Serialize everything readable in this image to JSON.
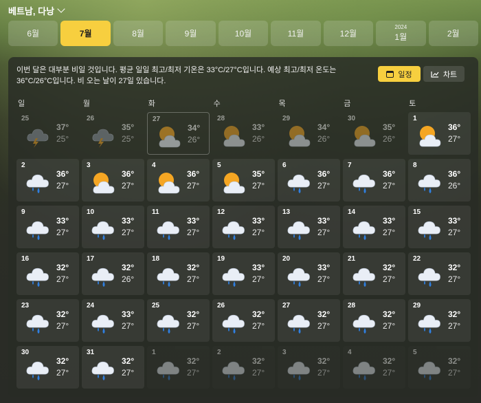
{
  "location": {
    "name": "베트남, 다낭"
  },
  "months": [
    {
      "label": "6월",
      "year": ""
    },
    {
      "label": "7월",
      "year": "",
      "active": true
    },
    {
      "label": "8월",
      "year": ""
    },
    {
      "label": "9월",
      "year": ""
    },
    {
      "label": "10월",
      "year": ""
    },
    {
      "label": "11월",
      "year": ""
    },
    {
      "label": "12월",
      "year": ""
    },
    {
      "label": "1월",
      "year": "2024"
    },
    {
      "label": "2월",
      "year": ""
    }
  ],
  "summary": "이번 달은 대부분 비일 것입니다. 평균 일일 최고/최저 기온은 33°C/27°C입니다. 예상 최고/최저 온도는 36°C/26°C입니다. 비 오는 날이 27일 있습니다.",
  "view_toggle": {
    "calendar_label": "일정",
    "chart_label": "차트"
  },
  "weekdays": [
    "일",
    "월",
    "화",
    "수",
    "목",
    "금",
    "토"
  ],
  "days": [
    {
      "d": "25",
      "hi": "37°",
      "lo": "25°",
      "icon": "thunderstorm-icon",
      "state": "dim"
    },
    {
      "d": "26",
      "hi": "35°",
      "lo": "25°",
      "icon": "thunderstorm-icon",
      "state": "dim"
    },
    {
      "d": "27",
      "hi": "34°",
      "lo": "26°",
      "icon": "partly-cloudy-icon",
      "state": "today"
    },
    {
      "d": "28",
      "hi": "33°",
      "lo": "26°",
      "icon": "partly-cloudy-icon",
      "state": "dim"
    },
    {
      "d": "29",
      "hi": "34°",
      "lo": "26°",
      "icon": "partly-cloudy-icon",
      "state": "dim"
    },
    {
      "d": "30",
      "hi": "35°",
      "lo": "26°",
      "icon": "partly-cloudy-icon",
      "state": "dim"
    },
    {
      "d": "1",
      "hi": "36°",
      "lo": "27°",
      "icon": "partly-cloudy-icon",
      "state": "normal"
    },
    {
      "d": "2",
      "hi": "36°",
      "lo": "27°",
      "icon": "rain-icon",
      "state": "normal"
    },
    {
      "d": "3",
      "hi": "36°",
      "lo": "27°",
      "icon": "partly-cloudy-icon",
      "state": "normal"
    },
    {
      "d": "4",
      "hi": "36°",
      "lo": "27°",
      "icon": "partly-cloudy-icon",
      "state": "normal"
    },
    {
      "d": "5",
      "hi": "35°",
      "lo": "27°",
      "icon": "partly-cloudy-icon",
      "state": "normal"
    },
    {
      "d": "6",
      "hi": "36°",
      "lo": "27°",
      "icon": "rain-icon",
      "state": "normal"
    },
    {
      "d": "7",
      "hi": "36°",
      "lo": "27°",
      "icon": "rain-icon",
      "state": "normal"
    },
    {
      "d": "8",
      "hi": "36°",
      "lo": "26°",
      "icon": "rain-icon",
      "state": "normal"
    },
    {
      "d": "9",
      "hi": "33°",
      "lo": "27°",
      "icon": "rain-icon",
      "state": "normal"
    },
    {
      "d": "10",
      "hi": "33°",
      "lo": "27°",
      "icon": "rain-icon",
      "state": "normal"
    },
    {
      "d": "11",
      "hi": "33°",
      "lo": "27°",
      "icon": "rain-icon",
      "state": "normal"
    },
    {
      "d": "12",
      "hi": "33°",
      "lo": "27°",
      "icon": "rain-icon",
      "state": "normal"
    },
    {
      "d": "13",
      "hi": "33°",
      "lo": "27°",
      "icon": "rain-icon",
      "state": "normal"
    },
    {
      "d": "14",
      "hi": "33°",
      "lo": "27°",
      "icon": "rain-icon",
      "state": "normal"
    },
    {
      "d": "15",
      "hi": "33°",
      "lo": "27°",
      "icon": "rain-icon",
      "state": "normal"
    },
    {
      "d": "16",
      "hi": "32°",
      "lo": "27°",
      "icon": "rain-icon",
      "state": "normal"
    },
    {
      "d": "17",
      "hi": "32°",
      "lo": "26°",
      "icon": "rain-icon",
      "state": "normal"
    },
    {
      "d": "18",
      "hi": "32°",
      "lo": "27°",
      "icon": "rain-icon",
      "state": "normal"
    },
    {
      "d": "19",
      "hi": "33°",
      "lo": "27°",
      "icon": "rain-icon",
      "state": "normal"
    },
    {
      "d": "20",
      "hi": "33°",
      "lo": "27°",
      "icon": "rain-icon",
      "state": "normal"
    },
    {
      "d": "21",
      "hi": "32°",
      "lo": "27°",
      "icon": "rain-icon",
      "state": "normal"
    },
    {
      "d": "22",
      "hi": "32°",
      "lo": "27°",
      "icon": "rain-icon",
      "state": "normal"
    },
    {
      "d": "23",
      "hi": "32°",
      "lo": "27°",
      "icon": "rain-icon",
      "state": "normal"
    },
    {
      "d": "24",
      "hi": "33°",
      "lo": "27°",
      "icon": "rain-icon",
      "state": "normal"
    },
    {
      "d": "25",
      "hi": "32°",
      "lo": "27°",
      "icon": "rain-icon",
      "state": "normal"
    },
    {
      "d": "26",
      "hi": "32°",
      "lo": "27°",
      "icon": "rain-icon",
      "state": "normal"
    },
    {
      "d": "27",
      "hi": "32°",
      "lo": "27°",
      "icon": "rain-icon",
      "state": "normal"
    },
    {
      "d": "28",
      "hi": "32°",
      "lo": "27°",
      "icon": "rain-icon",
      "state": "normal"
    },
    {
      "d": "29",
      "hi": "32°",
      "lo": "27°",
      "icon": "rain-icon",
      "state": "normal"
    },
    {
      "d": "30",
      "hi": "32°",
      "lo": "27°",
      "icon": "rain-icon",
      "state": "normal"
    },
    {
      "d": "31",
      "hi": "32°",
      "lo": "27°",
      "icon": "rain-icon",
      "state": "normal"
    },
    {
      "d": "1",
      "hi": "32°",
      "lo": "27°",
      "icon": "rain-icon",
      "state": "dimbox"
    },
    {
      "d": "2",
      "hi": "32°",
      "lo": "27°",
      "icon": "rain-icon",
      "state": "dimbox"
    },
    {
      "d": "3",
      "hi": "32°",
      "lo": "27°",
      "icon": "rain-icon",
      "state": "dimbox"
    },
    {
      "d": "4",
      "hi": "32°",
      "lo": "27°",
      "icon": "rain-icon",
      "state": "dimbox"
    },
    {
      "d": "5",
      "hi": "32°",
      "lo": "27°",
      "icon": "rain-icon",
      "state": "dimbox"
    }
  ],
  "colors": {
    "accent": "#f7cf3f",
    "sun": "#f5a623",
    "rain": "#2f7fe0",
    "cloud": "#e9eef6"
  }
}
